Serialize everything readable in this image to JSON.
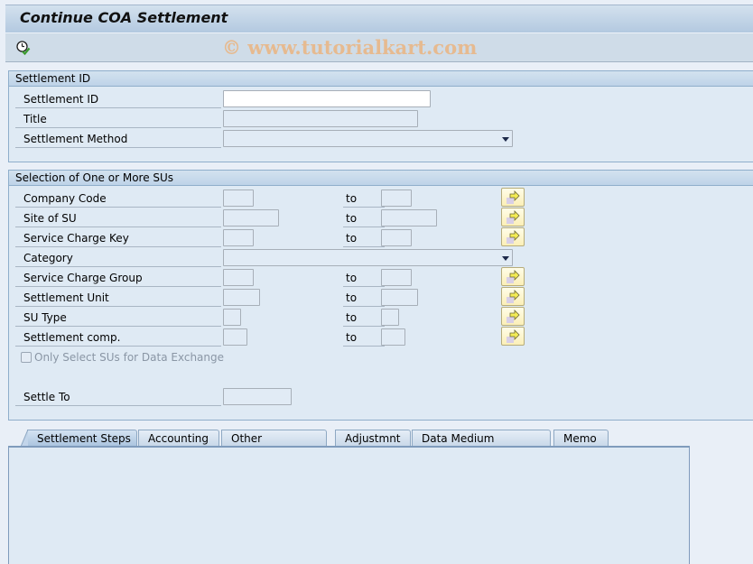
{
  "window": {
    "title": "Continue COA Settlement",
    "watermark": "© www.tutorialkart.com"
  },
  "toolbar": {
    "execute_icon": "execute-clock-check-icon"
  },
  "settlement_id_group": {
    "title": "Settlement ID",
    "fields": [
      {
        "label": "Settlement ID",
        "value": "",
        "type": "input",
        "editable": true
      },
      {
        "label": "Title",
        "value": "",
        "type": "input",
        "editable": false
      },
      {
        "label": "Settlement Method",
        "value": "",
        "type": "dropdown",
        "editable": false
      }
    ]
  },
  "selection_group": {
    "title": "Selection of One or More SUs",
    "to_label": "to",
    "multiple_selection_icon": "multiple-selection-arrow-icon",
    "rows": [
      {
        "label": "Company Code",
        "from": "",
        "to": ""
      },
      {
        "label": "Site of SU",
        "from": "",
        "to": ""
      },
      {
        "label": "Service Charge Key",
        "from": "",
        "to": ""
      },
      {
        "label": "Category",
        "value": "",
        "type": "dropdown"
      },
      {
        "label": "Service Charge Group",
        "from": "",
        "to": ""
      },
      {
        "label": "Settlement Unit",
        "from": "",
        "to": ""
      },
      {
        "label": "SU Type",
        "from": "",
        "to": ""
      },
      {
        "label": "Settlement comp.",
        "from": "",
        "to": ""
      }
    ],
    "checkbox": {
      "label": "Only Select SUs for Data Exchange",
      "checked": false,
      "enabled": false
    },
    "settle_to": {
      "label": "Settle To",
      "value": ""
    }
  },
  "tabs": [
    {
      "label": "Settlement Steps",
      "active": true
    },
    {
      "label": "Accounting",
      "active": false
    },
    {
      "label": "Other Parameters",
      "active": false
    },
    {
      "label": "Adjustmnt",
      "active": false
    },
    {
      "label": "Data Medium Exchange",
      "active": false
    },
    {
      "label": "Memo",
      "active": false
    }
  ]
}
